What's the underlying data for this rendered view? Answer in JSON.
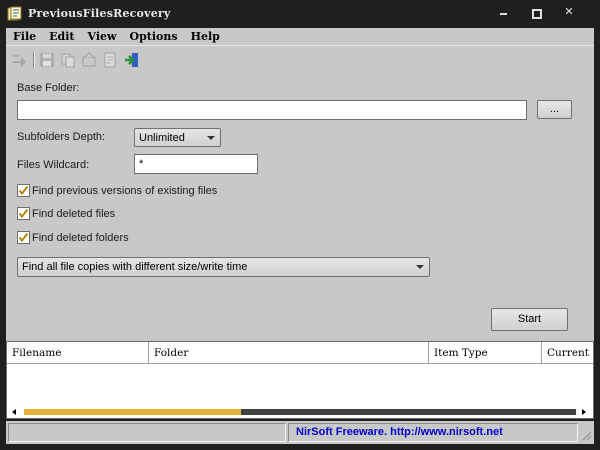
{
  "window": {
    "title": "PreviousFilesRecovery",
    "minimize_glyph": "",
    "maximize_glyph": "",
    "close_glyph": "✕"
  },
  "menu": [
    "File",
    "Edit",
    "View",
    "Options",
    "Help"
  ],
  "toolbar": {
    "icons": [
      "start-arrow-icon",
      "save-icon",
      "copy-icon",
      "properties-icon",
      "html-report-icon",
      "exit-icon"
    ]
  },
  "form": {
    "base_folder_label": "Base Folder:",
    "base_folder_value": "",
    "browse_label": "...",
    "subfolders_depth_label": "Subfolders Depth:",
    "subfolders_depth_value": "Unlimited",
    "files_wildcard_label": "Files Wildcard:",
    "files_wildcard_value": "*",
    "checkboxes": [
      {
        "label": "Find previous versions of existing files",
        "checked": true
      },
      {
        "label": "Find deleted files",
        "checked": true
      },
      {
        "label": "Find deleted folders",
        "checked": true
      }
    ],
    "mode_value": "Find all file copies with different size/write time",
    "start_label": "Start"
  },
  "list": {
    "columns": [
      "Filename",
      "Folder",
      "Item Type",
      "Current"
    ]
  },
  "status": {
    "link_text": "NirSoft Freeware.  http://www.nirsoft.net"
  },
  "colors": {
    "title_bg": "#1f1f1f",
    "panel_bg": "#c8c8c8",
    "scroll_thumb": "#e8b53a",
    "link": "#0000cc"
  }
}
